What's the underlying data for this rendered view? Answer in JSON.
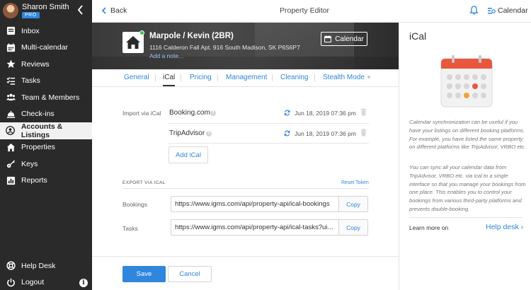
{
  "user": {
    "name": "Sharon Smith",
    "badge": "PRO"
  },
  "nav": [
    {
      "label": "Inbox",
      "icon": "inbox-icon"
    },
    {
      "label": "Multi-calendar",
      "icon": "calendar-icon"
    },
    {
      "label": "Reviews",
      "icon": "star-icon"
    },
    {
      "label": "Tasks",
      "icon": "tasks-icon"
    },
    {
      "label": "Team & Members",
      "icon": "team-icon"
    },
    {
      "label": "Check-ins",
      "icon": "bell-desk-icon"
    },
    {
      "label": "Accounts & Listings",
      "icon": "account-icon",
      "active": true
    },
    {
      "label": "Properties",
      "icon": "home-icon"
    },
    {
      "label": "Keys",
      "icon": "key-icon"
    },
    {
      "label": "Reports",
      "icon": "reports-icon"
    }
  ],
  "bottom_nav": [
    {
      "label": "Help Desk",
      "icon": "lifebuoy-icon"
    },
    {
      "label": "Logout",
      "icon": "power-icon"
    }
  ],
  "topbar": {
    "back": "Back",
    "title": "Property Editor",
    "calendar": "Calendar"
  },
  "listing": {
    "name": "Marpole / Kevin (2BR)",
    "address": "1116 Calderon Fall Apt. 916 South Madison, SK P6S6P7",
    "note": "Add a note...",
    "calendar_button": "Calendar"
  },
  "tabs": [
    "General",
    "iCal",
    "Pricing",
    "Management",
    "Cleaning",
    "Stealth Mode"
  ],
  "active_tab": "iCal",
  "import": {
    "label": "Import via iCal",
    "sources": [
      {
        "name": "Booking.com",
        "date": "Jun 18, 2019 07:36 pm"
      },
      {
        "name": "TripAdvisor",
        "date": "Jun 18, 2019 07:36 pm"
      }
    ],
    "add_button": "Add iCal"
  },
  "export": {
    "heading": "EXPORT VIA ICAL",
    "reset": "Reset Token",
    "rows": [
      {
        "label": "Bookings",
        "url": "https://www.igms.com/api/property-api/ical-bookings",
        "copy": "Copy"
      },
      {
        "label": "Tasks",
        "url": "https://www.igms.com/api/property-api/ical-tasks?ui...",
        "copy": "Copy"
      }
    ]
  },
  "footer": {
    "save": "Save",
    "cancel": "Cancel"
  },
  "panel": {
    "title": "iCal",
    "p1": "Calendar synchronization can be useful if you have your listings on different booking platforms. For example, you have listed the same property on different platforms like TripAdvisor, VRBO etc.",
    "p2": "You can sync all your calendar data from TripAdvisor, VRBO etc. via ical to a single interface so that you manage your bookings from one place. This enables you to control your bookings from various third-party platforms and prevents double-booking.",
    "learn_more": "Learn more on",
    "help_desk": "Help desk"
  },
  "colors": {
    "accent": "#2f86dd",
    "sidebar": "#2a2a2a",
    "online": "#3cc14e",
    "calendar_header": "#e9573f"
  }
}
